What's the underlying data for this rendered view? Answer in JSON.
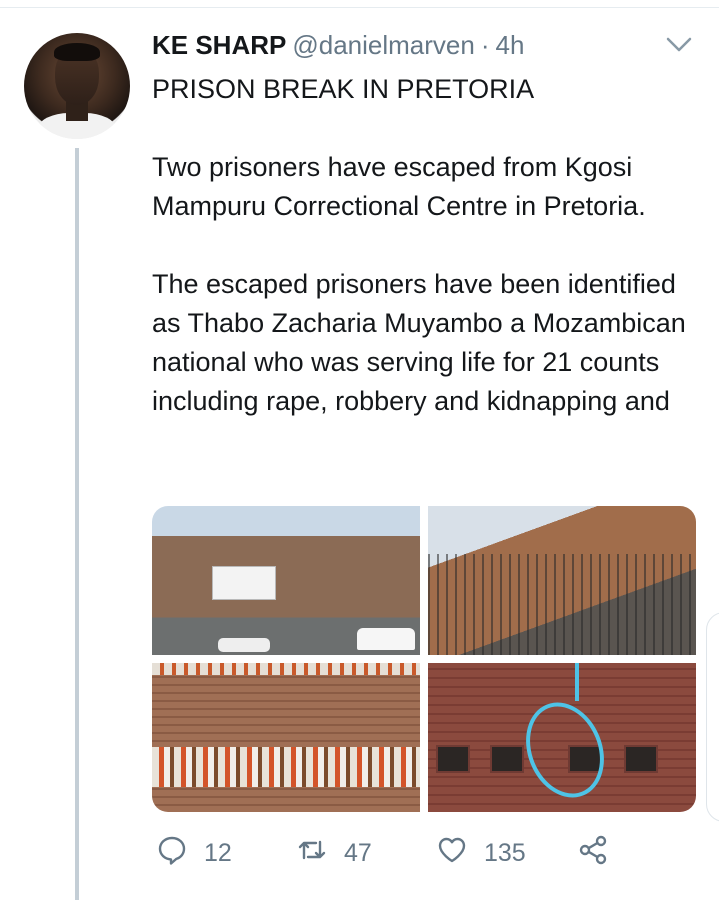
{
  "tweet": {
    "display_name": "KE SHARP",
    "handle": "@danielmarven",
    "separator": "·",
    "time": "4h",
    "headline": "PRISON BREAK IN PRETORIA",
    "paragraph1": "Two prisoners have escaped from Kgosi Mampuru Correctional Centre in Pretoria.",
    "paragraph2": "The escaped prisoners have been identified as Thabo Zacharia Muyambo a Mozambican national who was serving life for 21 counts including rape, robbery and kidnapping and"
  },
  "media": [
    {
      "icon": "prison-exterior-photo"
    },
    {
      "icon": "prison-fence-photo"
    },
    {
      "icon": "prison-laundry-photo"
    },
    {
      "icon": "prison-window-marked-photo"
    }
  ],
  "actions": {
    "reply_count": "12",
    "retweet_count": "47",
    "like_count": "135"
  },
  "colors": {
    "text": "#14171a",
    "secondary": "#657786",
    "thread_line": "#c4ced6",
    "highlight_circle": "#4ec3e6"
  }
}
